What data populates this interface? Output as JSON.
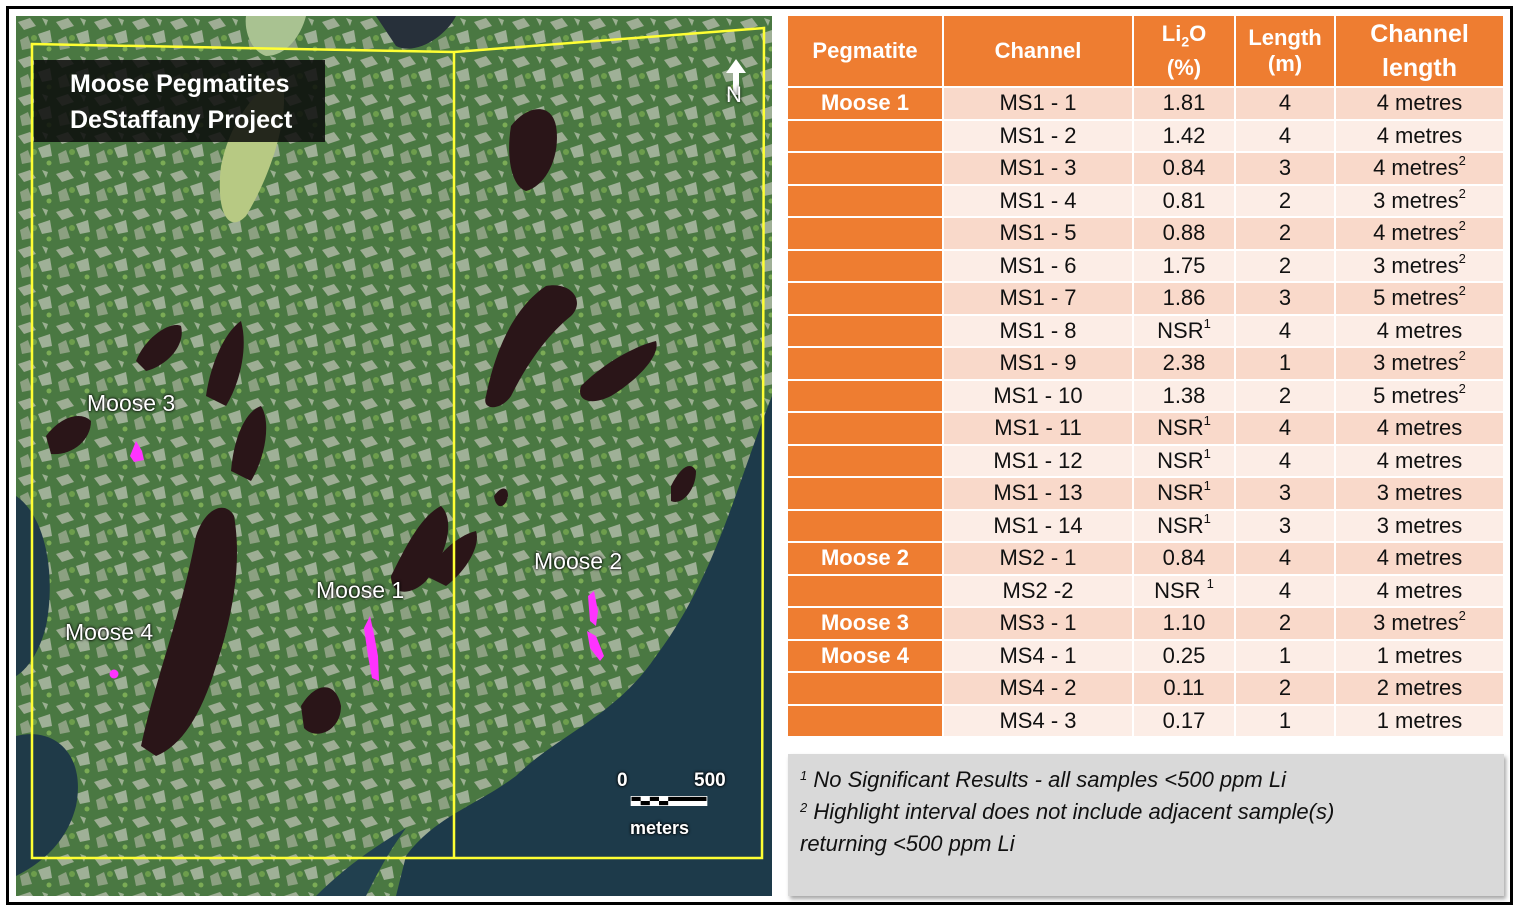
{
  "map": {
    "title_line1": "Moose Pegmatites",
    "title_line2": "DeStaffany Project",
    "labels": {
      "moose3": "Moose 3",
      "moose1": "Moose 1",
      "moose2": "Moose 2",
      "moose4": "Moose 4"
    },
    "north": "N",
    "scale": {
      "zero": "0",
      "max": "500",
      "unit": "meters"
    },
    "colors": {
      "boundary": "#ffff33",
      "pegmatite": "#ff33ff",
      "water": "#2a1518",
      "sea": "#1d3a4a"
    }
  },
  "table": {
    "headers": {
      "pegmatite": "Pegmatite",
      "channel": "Channel",
      "li2o_a": "Li",
      "li2o_sub": "2",
      "li2o_b": "O",
      "li2o_unit": "(%)",
      "length": "Length",
      "length_unit": "(m)",
      "channel_length_a": "Channel",
      "channel_length_b": "length"
    },
    "rows": [
      {
        "peg": "Moose 1",
        "ch": "MS1 - 1",
        "li": "1.81",
        "li_sup": "",
        "len": "4",
        "cl": "4 metres",
        "cl_sup": ""
      },
      {
        "peg": "",
        "ch": "MS1 - 2",
        "li": "1.42",
        "li_sup": "",
        "len": "4",
        "cl": "4 metres",
        "cl_sup": ""
      },
      {
        "peg": "",
        "ch": "MS1 - 3",
        "li": "0.84",
        "li_sup": "",
        "len": "3",
        "cl": "4 metres",
        "cl_sup": "2"
      },
      {
        "peg": "",
        "ch": "MS1 - 4",
        "li": "0.81",
        "li_sup": "",
        "len": "2",
        "cl": "3 metres",
        "cl_sup": "2"
      },
      {
        "peg": "",
        "ch": "MS1 - 5",
        "li": "0.88",
        "li_sup": "",
        "len": "2",
        "cl": "4 metres",
        "cl_sup": "2"
      },
      {
        "peg": "",
        "ch": "MS1 - 6",
        "li": "1.75",
        "li_sup": "",
        "len": "2",
        "cl": "3 metres",
        "cl_sup": "2"
      },
      {
        "peg": "",
        "ch": "MS1 - 7",
        "li": "1.86",
        "li_sup": "",
        "len": "3",
        "cl": "5 metres",
        "cl_sup": "2"
      },
      {
        "peg": "",
        "ch": "MS1 - 8",
        "li": "NSR",
        "li_sup": "1",
        "len": "4",
        "cl": "4 metres",
        "cl_sup": ""
      },
      {
        "peg": "",
        "ch": "MS1 - 9",
        "li": "2.38",
        "li_sup": "",
        "len": "1",
        "cl": "3 metres",
        "cl_sup": "2"
      },
      {
        "peg": "",
        "ch": "MS1 - 10",
        "li": "1.38",
        "li_sup": "",
        "len": "2",
        "cl": "5 metres",
        "cl_sup": "2"
      },
      {
        "peg": "",
        "ch": "MS1 - 11",
        "li": "NSR",
        "li_sup": "1",
        "len": "4",
        "cl": "4 metres",
        "cl_sup": ""
      },
      {
        "peg": "",
        "ch": "MS1 - 12",
        "li": "NSR",
        "li_sup": "1",
        "len": "4",
        "cl": "4 metres",
        "cl_sup": ""
      },
      {
        "peg": "",
        "ch": "MS1 - 13",
        "li": "NSR",
        "li_sup": "1",
        "len": "3",
        "cl": "3 metres",
        "cl_sup": ""
      },
      {
        "peg": "",
        "ch": "MS1 - 14",
        "li": "NSR",
        "li_sup": "1",
        "len": "3",
        "cl": "3 metres",
        "cl_sup": ""
      },
      {
        "peg": "Moose 2",
        "ch": "MS2 - 1",
        "li": "0.84",
        "li_sup": "",
        "len": "4",
        "cl": "4 metres",
        "cl_sup": ""
      },
      {
        "peg": "",
        "ch": "MS2 -2",
        "li": "NSR ",
        "li_sup": "1",
        "len": "4",
        "cl": "4 metres",
        "cl_sup": ""
      },
      {
        "peg": "Moose 3",
        "ch": "MS3 - 1",
        "li": "1.10",
        "li_sup": "",
        "len": "2",
        "cl": "3 metres",
        "cl_sup": "2"
      },
      {
        "peg": "Moose 4",
        "ch": "MS4 - 1",
        "li": "0.25",
        "li_sup": "",
        "len": "1",
        "cl": "1 metres",
        "cl_sup": ""
      },
      {
        "peg": "",
        "ch": "MS4 - 2",
        "li": "0.11",
        "li_sup": "",
        "len": "2",
        "cl": "2 metres",
        "cl_sup": ""
      },
      {
        "peg": "",
        "ch": "MS4 - 3",
        "li": "0.17",
        "li_sup": "",
        "len": "1",
        "cl": "1 metres",
        "cl_sup": ""
      }
    ]
  },
  "notes": {
    "n1_mark": "1",
    "n1_text": " No Significant Results - all samples <500 ppm Li",
    "n2_mark": "2",
    "n2_text": " Highlight interval does not include adjacent sample(s)",
    "n2_text_cont": "returning <500 ppm Li"
  }
}
